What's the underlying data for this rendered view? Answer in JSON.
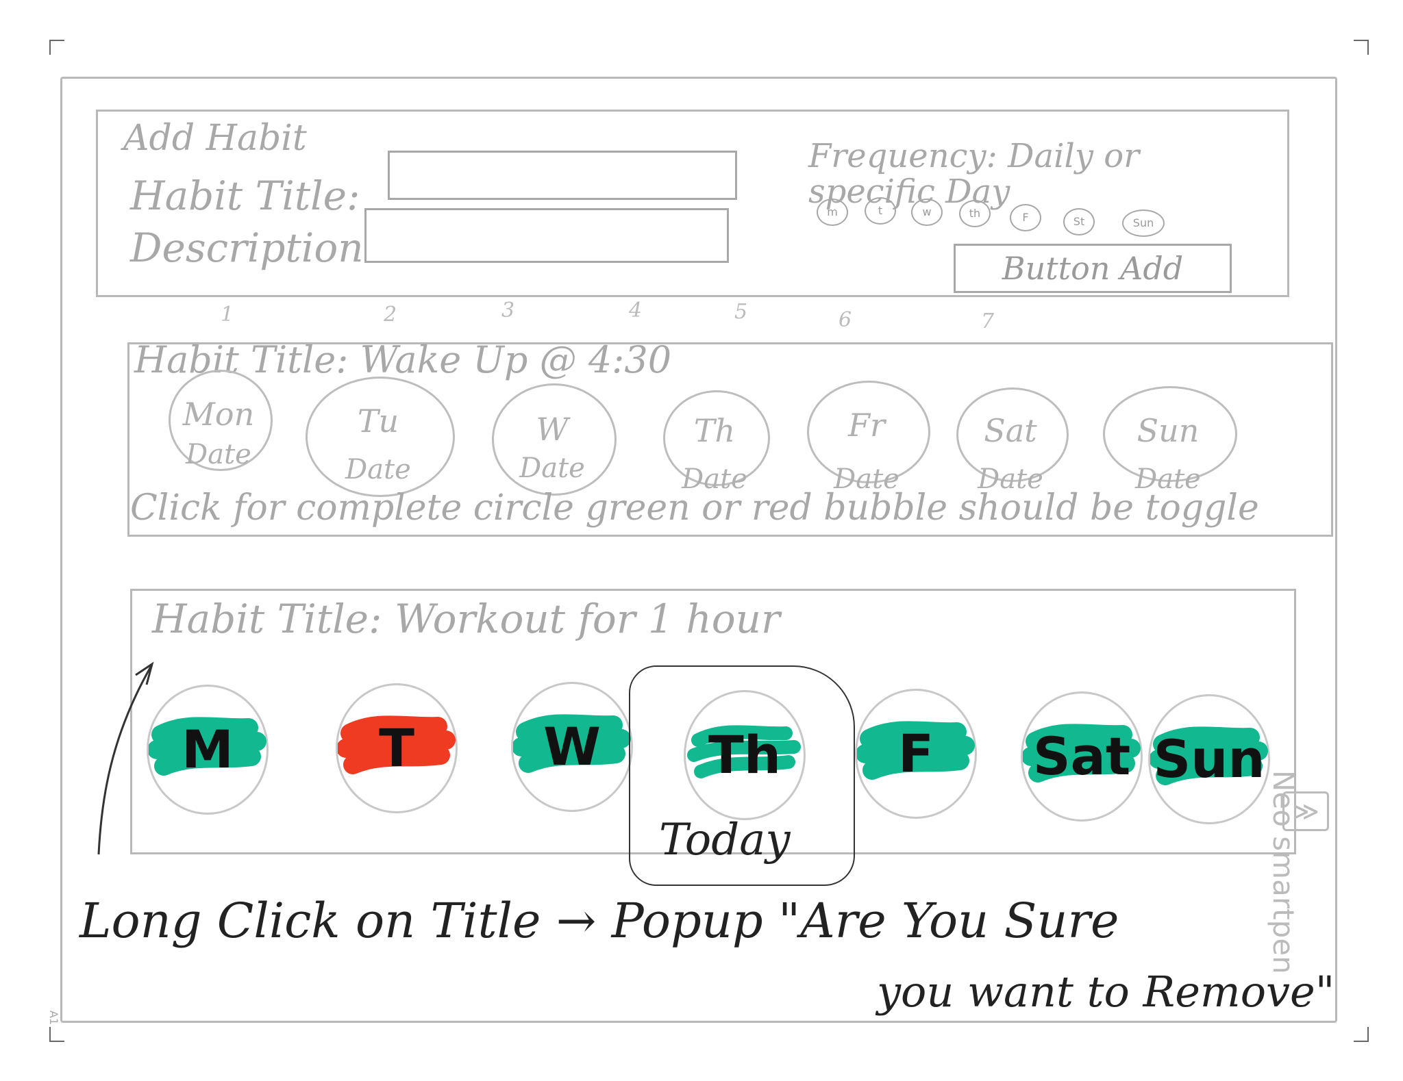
{
  "add_habit": {
    "heading": "Add Habit",
    "title_label": "Habit Title:",
    "description_label": "Description",
    "frequency_label": "Frequency: Daily or specific Day",
    "days": [
      "m",
      "t",
      "w",
      "th",
      "F",
      "St",
      "Sun"
    ],
    "button_label": "Button Add"
  },
  "column_numbers": [
    "1",
    "2",
    "3",
    "4",
    "5",
    "6",
    "7"
  ],
  "habit_one": {
    "title": "Habit Title: Wake Up @ 4:30",
    "days": [
      {
        "day": "Mon",
        "date": "Date"
      },
      {
        "day": "Tu",
        "date": "Date"
      },
      {
        "day": "W",
        "date": "Date"
      },
      {
        "day": "Th",
        "date": "Date"
      },
      {
        "day": "Fr",
        "date": "Date"
      },
      {
        "day": "Sat",
        "date": "Date"
      },
      {
        "day": "Sun",
        "date": "Date"
      }
    ],
    "note": "Click for complete circle green or red bubble should be toggle"
  },
  "habit_two": {
    "title": "Habit Title: Workout for 1 hour",
    "days": [
      {
        "label": "M",
        "status": "complete"
      },
      {
        "label": "T",
        "status": "missed"
      },
      {
        "label": "W",
        "status": "complete"
      },
      {
        "label": "Th",
        "status": "today"
      },
      {
        "label": "F",
        "status": "complete"
      },
      {
        "label": "Sat",
        "status": "complete"
      },
      {
        "label": "Sun",
        "status": "complete"
      }
    ],
    "today_label": "Today",
    "long_click_note_1": "Long Click on Title → Popup \"Are You Sure",
    "long_click_note_2": "you want to Remove\""
  },
  "brand": {
    "text": "Neo smartpen",
    "page_mark": "A1"
  },
  "colors": {
    "sketch": "#b8b8b8",
    "complete": "#12b88f",
    "missed": "#f03b23",
    "ink": "#111111"
  }
}
